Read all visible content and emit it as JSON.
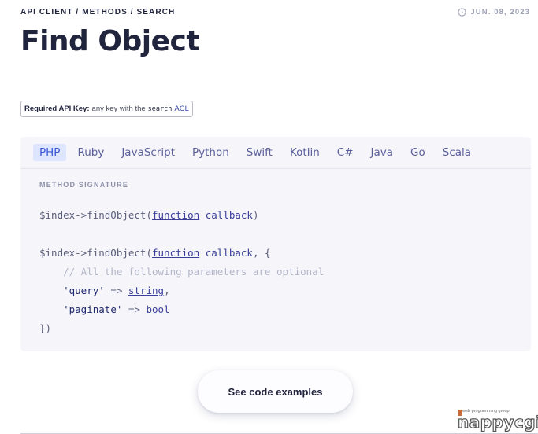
{
  "breadcrumb": "API CLIENT / METHODS / SEARCH",
  "date": "JUN. 08, 2023",
  "title": "Find Object",
  "api_key": {
    "label": "Required API Key:",
    "text": "any key with the",
    "code": "search",
    "acl": "ACL"
  },
  "tabs": [
    {
      "label": "PHP",
      "active": true
    },
    {
      "label": "Ruby",
      "active": false
    },
    {
      "label": "JavaScript",
      "active": false
    },
    {
      "label": "Python",
      "active": false
    },
    {
      "label": "Swift",
      "active": false
    },
    {
      "label": "Kotlin",
      "active": false
    },
    {
      "label": "C#",
      "active": false
    },
    {
      "label": "Java",
      "active": false
    },
    {
      "label": "Go",
      "active": false
    },
    {
      "label": "Scala",
      "active": false
    }
  ],
  "signature_label": "METHOD SIGNATURE",
  "code": {
    "l1_prefix": "$index->findObject(",
    "kw_function": "function",
    "callback": "callback",
    "l1_suffix": ")",
    "l3_suffix": ", {",
    "comment": "// All the following parameters are optional",
    "query_key": "'query'",
    "arrow": " => ",
    "query_type": "string",
    "comma": ",",
    "paginate_key": "'paginate'",
    "paginate_type": "bool",
    "close": "})"
  },
  "button_label": "See code examples",
  "watermark": {
    "small": "web programming group",
    "big": "nappycgi"
  },
  "colors": {
    "accent": "#3a57d6",
    "active_tab_bg": "#dde5ff",
    "panel_bg": "#f5f5fa"
  }
}
